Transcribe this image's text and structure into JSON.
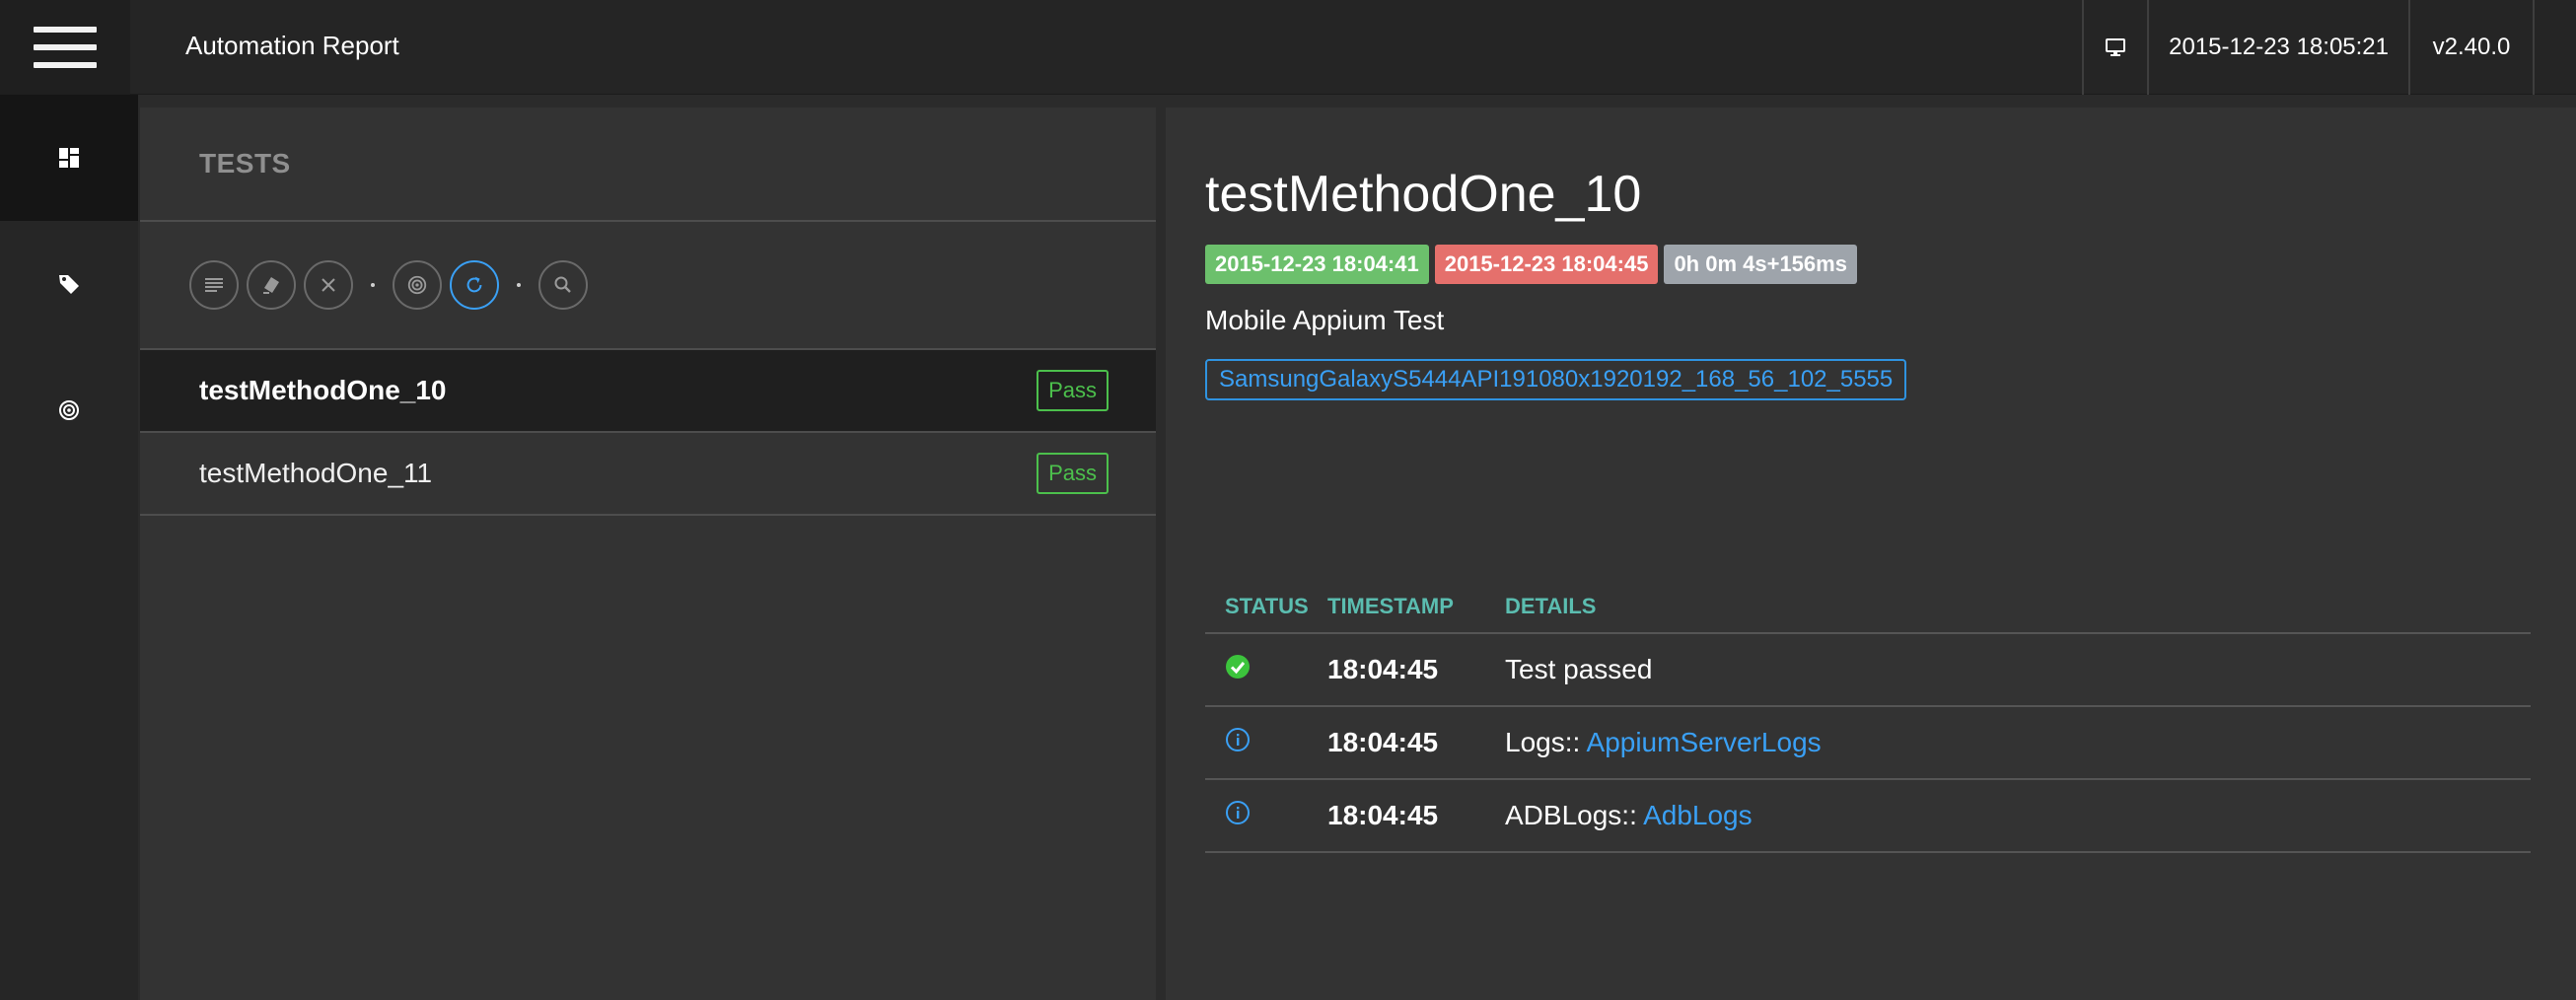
{
  "app": {
    "title": "Automation Report"
  },
  "topbar": {
    "datetime": "2015-12-23 18:05:21",
    "version": "v2.40.0",
    "monitor_icon": "monitor-icon"
  },
  "sidebar": {
    "items": [
      {
        "name": "dashboard",
        "icon": "dashboard-icon",
        "active": true
      },
      {
        "name": "tags",
        "icon": "tag-icon",
        "active": false
      },
      {
        "name": "radar",
        "icon": "radar-icon",
        "active": false
      }
    ]
  },
  "tests_panel": {
    "heading": "TESTS",
    "toolbar": [
      "list-icon",
      "eraser-icon",
      "close-icon",
      "radar-icon",
      "refresh-icon",
      "search-icon"
    ],
    "tests": [
      {
        "name": "testMethodOne_10",
        "status": "Pass"
      },
      {
        "name": "testMethodOne_11",
        "status": "Pass"
      }
    ]
  },
  "detail": {
    "title": "testMethodOne_10",
    "start": "2015-12-23 18:04:41",
    "end": "2015-12-23 18:04:45",
    "duration": "0h 0m 4s+156ms",
    "description": "Mobile Appium Test",
    "device": "SamsungGalaxyS5444API191080x1920192_168_56_102_5555",
    "columns": {
      "status": "STATUS",
      "timestamp": "TIMESTAMP",
      "details": "DETAILS"
    },
    "logs": [
      {
        "icon": "check-circle-icon",
        "time": "18:04:45",
        "prefix": "Test passed",
        "link": ""
      },
      {
        "icon": "info-icon",
        "time": "18:04:45",
        "prefix": "Logs:: ",
        "link": "AppiumServerLogs"
      },
      {
        "icon": "info-icon",
        "time": "18:04:45",
        "prefix": "ADBLogs:: ",
        "link": "AdbLogs"
      }
    ]
  },
  "colors": {
    "pass": "#4cc04c",
    "start": "#6cc06c",
    "end": "#e5706c",
    "duration": "#9ea4ab",
    "link": "#3aa0f5",
    "header_teal": "#5bbdb0"
  }
}
